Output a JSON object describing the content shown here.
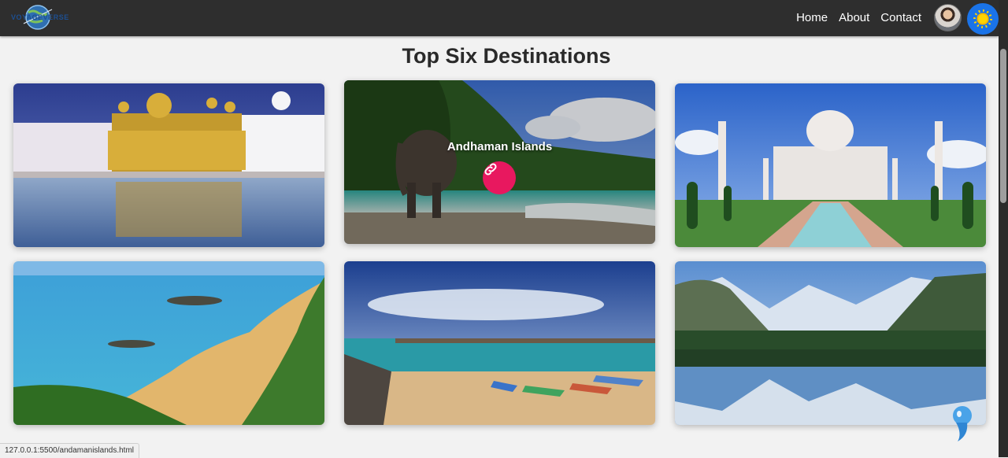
{
  "navbar": {
    "logo_text": "VOYAGEVERSE",
    "links": [
      "Home",
      "About",
      "Contact"
    ]
  },
  "section": {
    "title": "Top Six Destinations"
  },
  "cards": [
    {
      "name": "golden-temple",
      "label": ""
    },
    {
      "name": "andaman",
      "label": "Andhaman Islands"
    },
    {
      "name": "taj-mahal",
      "label": ""
    },
    {
      "name": "goa-beach",
      "label": ""
    },
    {
      "name": "pier-beach",
      "label": ""
    },
    {
      "name": "lake-mountains",
      "label": ""
    }
  ],
  "status_bar": {
    "url": "127.0.0.1:5500/andamanislands.html"
  },
  "colors": {
    "navbar_bg": "#2e2e2e",
    "accent_link_button": "#e8185f",
    "theme_toggle": "#1a73e8"
  },
  "icons": {
    "link": "link-icon",
    "theme": "sun-icon",
    "chat": "chatbot-icon"
  }
}
